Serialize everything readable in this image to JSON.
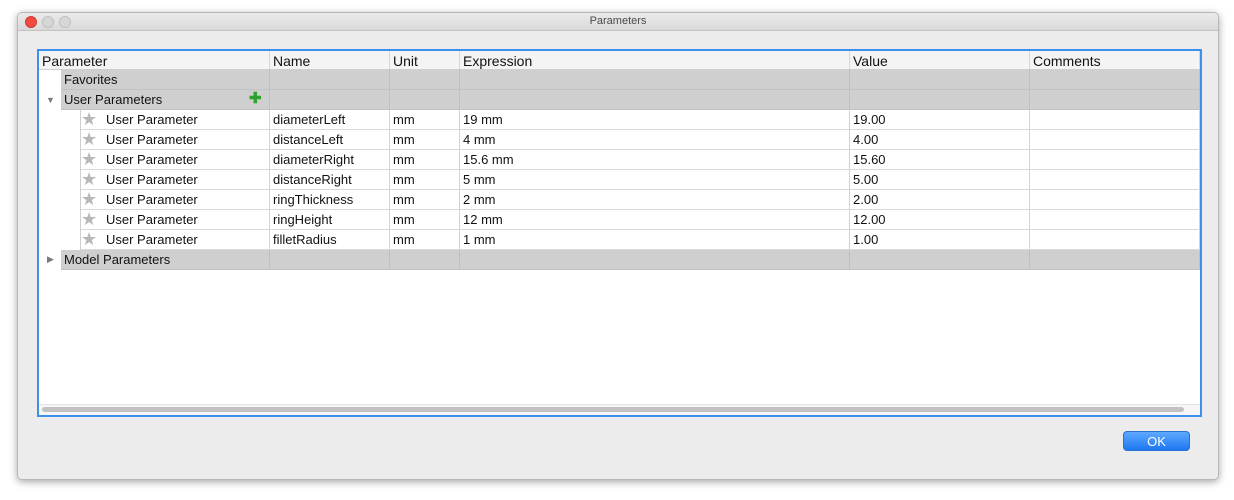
{
  "window": {
    "title": "Parameters"
  },
  "columns": [
    "Parameter",
    "Name",
    "Unit",
    "Expression",
    "Value",
    "Comments"
  ],
  "groups": {
    "favorites": {
      "label": "Favorites"
    },
    "user": {
      "label": "User Parameters",
      "expanded": true
    },
    "model": {
      "label": "Model Parameters",
      "expanded": false
    }
  },
  "user_parameters": [
    {
      "parameter": "User Parameter",
      "name": "diameterLeft",
      "unit": "mm",
      "expression": "19 mm",
      "value": "19.00",
      "comments": ""
    },
    {
      "parameter": "User Parameter",
      "name": "distanceLeft",
      "unit": "mm",
      "expression": "4 mm",
      "value": "4.00",
      "comments": ""
    },
    {
      "parameter": "User Parameter",
      "name": "diameterRight",
      "unit": "mm",
      "expression": "15.6 mm",
      "value": "15.60",
      "comments": ""
    },
    {
      "parameter": "User Parameter",
      "name": "distanceRight",
      "unit": "mm",
      "expression": "5 mm",
      "value": "5.00",
      "comments": ""
    },
    {
      "parameter": "User Parameter",
      "name": "ringThickness",
      "unit": "mm",
      "expression": "2 mm",
      "value": "2.00",
      "comments": ""
    },
    {
      "parameter": "User Parameter",
      "name": "ringHeight",
      "unit": "mm",
      "expression": "12 mm",
      "value": "12.00",
      "comments": ""
    },
    {
      "parameter": "User Parameter",
      "name": "filletRadius",
      "unit": "mm",
      "expression": "1 mm",
      "value": "1.00",
      "comments": ""
    }
  ],
  "buttons": {
    "ok": "OK"
  },
  "colors": {
    "accent": "#3f8ff0",
    "group_bg": "#cfcfcf",
    "add_icon": "#2ea22e"
  }
}
